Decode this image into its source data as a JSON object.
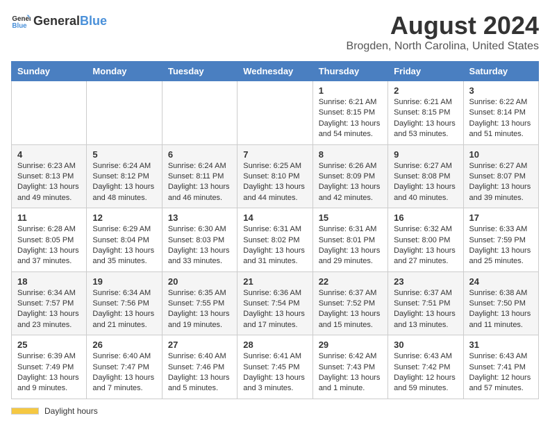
{
  "header": {
    "logo_general": "General",
    "logo_blue": "Blue",
    "title": "August 2024",
    "subtitle": "Brogden, North Carolina, United States"
  },
  "calendar": {
    "days_of_week": [
      "Sunday",
      "Monday",
      "Tuesday",
      "Wednesday",
      "Thursday",
      "Friday",
      "Saturday"
    ],
    "weeks": [
      [
        {
          "day": "",
          "info": ""
        },
        {
          "day": "",
          "info": ""
        },
        {
          "day": "",
          "info": ""
        },
        {
          "day": "",
          "info": ""
        },
        {
          "day": "1",
          "sunrise": "6:21 AM",
          "sunset": "8:15 PM",
          "daylight": "13 hours and 54 minutes."
        },
        {
          "day": "2",
          "sunrise": "6:21 AM",
          "sunset": "8:15 PM",
          "daylight": "13 hours and 53 minutes."
        },
        {
          "day": "3",
          "sunrise": "6:22 AM",
          "sunset": "8:14 PM",
          "daylight": "13 hours and 51 minutes."
        }
      ],
      [
        {
          "day": "4",
          "sunrise": "6:23 AM",
          "sunset": "8:13 PM",
          "daylight": "13 hours and 49 minutes."
        },
        {
          "day": "5",
          "sunrise": "6:24 AM",
          "sunset": "8:12 PM",
          "daylight": "13 hours and 48 minutes."
        },
        {
          "day": "6",
          "sunrise": "6:24 AM",
          "sunset": "8:11 PM",
          "daylight": "13 hours and 46 minutes."
        },
        {
          "day": "7",
          "sunrise": "6:25 AM",
          "sunset": "8:10 PM",
          "daylight": "13 hours and 44 minutes."
        },
        {
          "day": "8",
          "sunrise": "6:26 AM",
          "sunset": "8:09 PM",
          "daylight": "13 hours and 42 minutes."
        },
        {
          "day": "9",
          "sunrise": "6:27 AM",
          "sunset": "8:08 PM",
          "daylight": "13 hours and 40 minutes."
        },
        {
          "day": "10",
          "sunrise": "6:27 AM",
          "sunset": "8:07 PM",
          "daylight": "13 hours and 39 minutes."
        }
      ],
      [
        {
          "day": "11",
          "sunrise": "6:28 AM",
          "sunset": "8:05 PM",
          "daylight": "13 hours and 37 minutes."
        },
        {
          "day": "12",
          "sunrise": "6:29 AM",
          "sunset": "8:04 PM",
          "daylight": "13 hours and 35 minutes."
        },
        {
          "day": "13",
          "sunrise": "6:30 AM",
          "sunset": "8:03 PM",
          "daylight": "13 hours and 33 minutes."
        },
        {
          "day": "14",
          "sunrise": "6:31 AM",
          "sunset": "8:02 PM",
          "daylight": "13 hours and 31 minutes."
        },
        {
          "day": "15",
          "sunrise": "6:31 AM",
          "sunset": "8:01 PM",
          "daylight": "13 hours and 29 minutes."
        },
        {
          "day": "16",
          "sunrise": "6:32 AM",
          "sunset": "8:00 PM",
          "daylight": "13 hours and 27 minutes."
        },
        {
          "day": "17",
          "sunrise": "6:33 AM",
          "sunset": "7:59 PM",
          "daylight": "13 hours and 25 minutes."
        }
      ],
      [
        {
          "day": "18",
          "sunrise": "6:34 AM",
          "sunset": "7:57 PM",
          "daylight": "13 hours and 23 minutes."
        },
        {
          "day": "19",
          "sunrise": "6:34 AM",
          "sunset": "7:56 PM",
          "daylight": "13 hours and 21 minutes."
        },
        {
          "day": "20",
          "sunrise": "6:35 AM",
          "sunset": "7:55 PM",
          "daylight": "13 hours and 19 minutes."
        },
        {
          "day": "21",
          "sunrise": "6:36 AM",
          "sunset": "7:54 PM",
          "daylight": "13 hours and 17 minutes."
        },
        {
          "day": "22",
          "sunrise": "6:37 AM",
          "sunset": "7:52 PM",
          "daylight": "13 hours and 15 minutes."
        },
        {
          "day": "23",
          "sunrise": "6:37 AM",
          "sunset": "7:51 PM",
          "daylight": "13 hours and 13 minutes."
        },
        {
          "day": "24",
          "sunrise": "6:38 AM",
          "sunset": "7:50 PM",
          "daylight": "13 hours and 11 minutes."
        }
      ],
      [
        {
          "day": "25",
          "sunrise": "6:39 AM",
          "sunset": "7:49 PM",
          "daylight": "13 hours and 9 minutes."
        },
        {
          "day": "26",
          "sunrise": "6:40 AM",
          "sunset": "7:47 PM",
          "daylight": "13 hours and 7 minutes."
        },
        {
          "day": "27",
          "sunrise": "6:40 AM",
          "sunset": "7:46 PM",
          "daylight": "13 hours and 5 minutes."
        },
        {
          "day": "28",
          "sunrise": "6:41 AM",
          "sunset": "7:45 PM",
          "daylight": "13 hours and 3 minutes."
        },
        {
          "day": "29",
          "sunrise": "6:42 AM",
          "sunset": "7:43 PM",
          "daylight": "13 hours and 1 minute."
        },
        {
          "day": "30",
          "sunrise": "6:43 AM",
          "sunset": "7:42 PM",
          "daylight": "12 hours and 59 minutes."
        },
        {
          "day": "31",
          "sunrise": "6:43 AM",
          "sunset": "7:41 PM",
          "daylight": "12 hours and 57 minutes."
        }
      ]
    ]
  },
  "footer": {
    "daylight_label": "Daylight hours"
  }
}
